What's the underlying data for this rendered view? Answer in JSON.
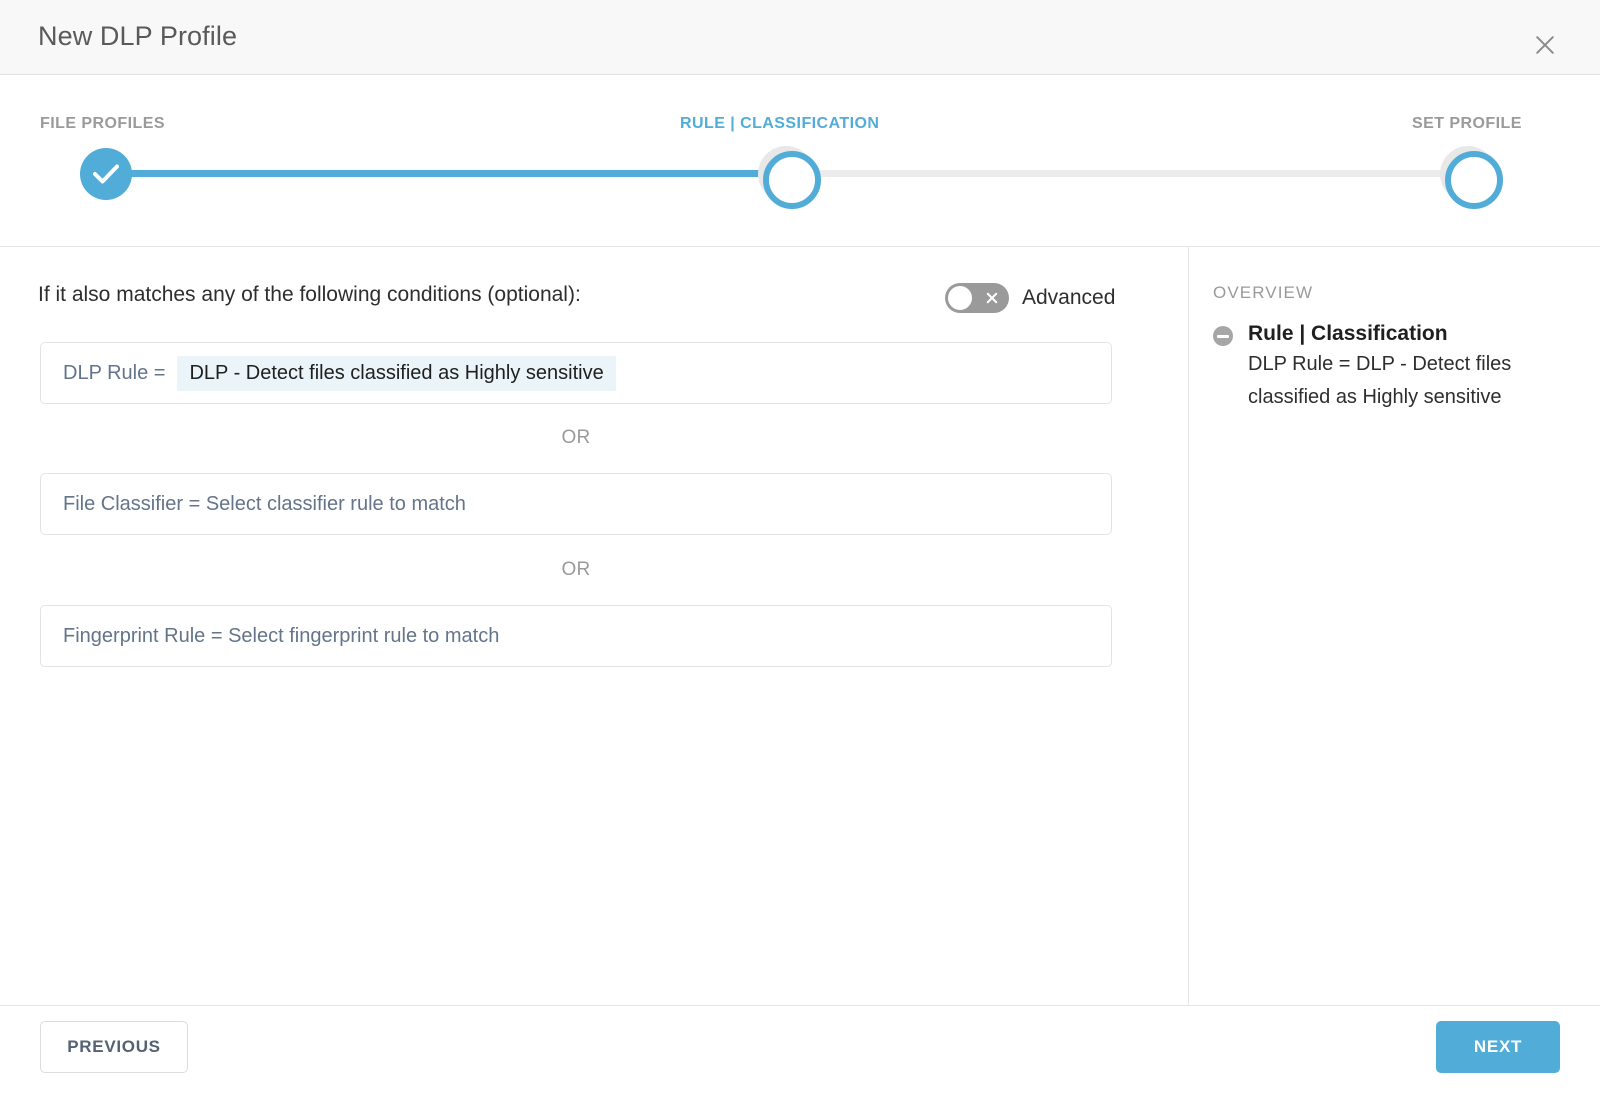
{
  "header": {
    "title": "New DLP Profile",
    "close_icon": "close-icon"
  },
  "stepper": {
    "steps": [
      {
        "label": "FILE PROFILES",
        "state": "completed",
        "icon": "check-icon"
      },
      {
        "label": "RULE | CLASSIFICATION",
        "state": "active",
        "icon": "circle-icon"
      },
      {
        "label": "SET PROFILE",
        "state": "upcoming",
        "icon": "circle-icon"
      }
    ],
    "accent_color": "#51acd8",
    "track_color": "#ececec"
  },
  "main": {
    "prompt": "If it also matches any of the following conditions (optional):",
    "advanced": {
      "label": "Advanced",
      "state": "off",
      "knob_icon": "close-icon"
    },
    "or_labels": [
      "OR",
      "OR"
    ],
    "conditions": [
      {
        "label": "DLP Rule =",
        "value": "DLP - Detect files classified as Highly sensitive",
        "filled": true,
        "chip_bg": "#eaf4f9"
      },
      {
        "placeholder": "File Classifier = Select classifier rule to match",
        "filled": false
      },
      {
        "placeholder": "Fingerprint Rule = Select fingerprint rule to match",
        "filled": false
      }
    ]
  },
  "overview": {
    "title": "OVERVIEW",
    "item": {
      "collapse_icon": "minus-circle-icon",
      "heading": "Rule | Classification",
      "detail": "DLP Rule = DLP - Detect files classified as Highly sensitive"
    }
  },
  "footer": {
    "previous_label": "PREVIOUS",
    "next_label": "NEXT",
    "next_color": "#51acd8"
  }
}
